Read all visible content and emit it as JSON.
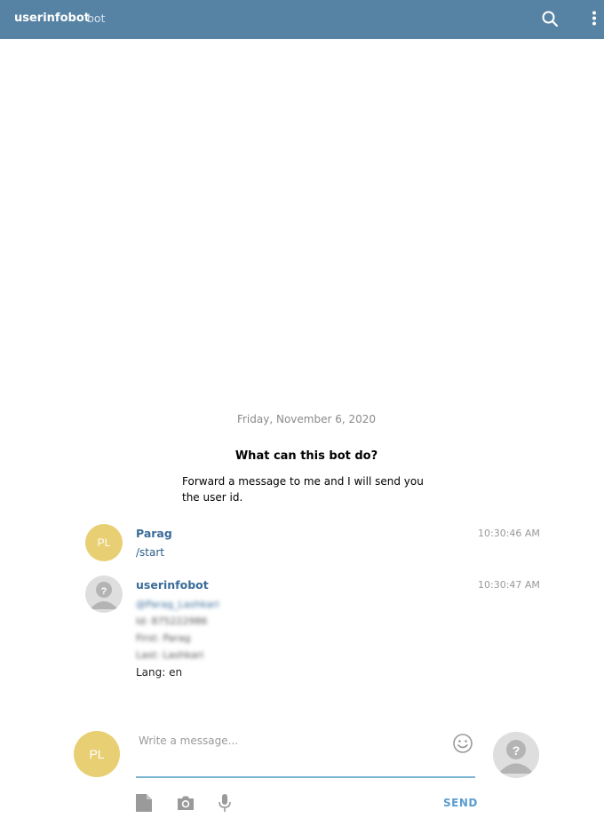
{
  "header": {
    "title": "userinfobot",
    "subtitle": "bot",
    "icons": [
      "search-icon",
      "more-vert-icon"
    ]
  },
  "chat": {
    "date": "Friday, November 6, 2020",
    "bot_info": {
      "title": "What can this bot do?",
      "description_line1": "Forward a message to me and I will send you",
      "description_line2": "the user id."
    },
    "messages": [
      {
        "author": "Parag",
        "avatar_initials": "PL",
        "time": "10:30:46 AM",
        "text": "/start"
      },
      {
        "author": "userinfobot",
        "avatar": "unknown-user-icon",
        "time": "10:30:47 AM",
        "redacted_lines": [
          "@Parag_Lashkari",
          "Id: 875222986",
          "First: Parag",
          "Last: Lashkari"
        ],
        "last_line": "Lang: en"
      }
    ]
  },
  "composer": {
    "avatar_initials": "PL",
    "placeholder": "Write a message...",
    "send_label": "SEND",
    "tools": [
      "attach-file-icon",
      "camera-icon",
      "microphone-icon"
    ]
  },
  "colors": {
    "header_bg": "#5682a3",
    "user_avatar": "#e8cf73",
    "link": "#3a6d99",
    "send": "#5a9dd0",
    "input_underline": "#7cb6d0"
  }
}
